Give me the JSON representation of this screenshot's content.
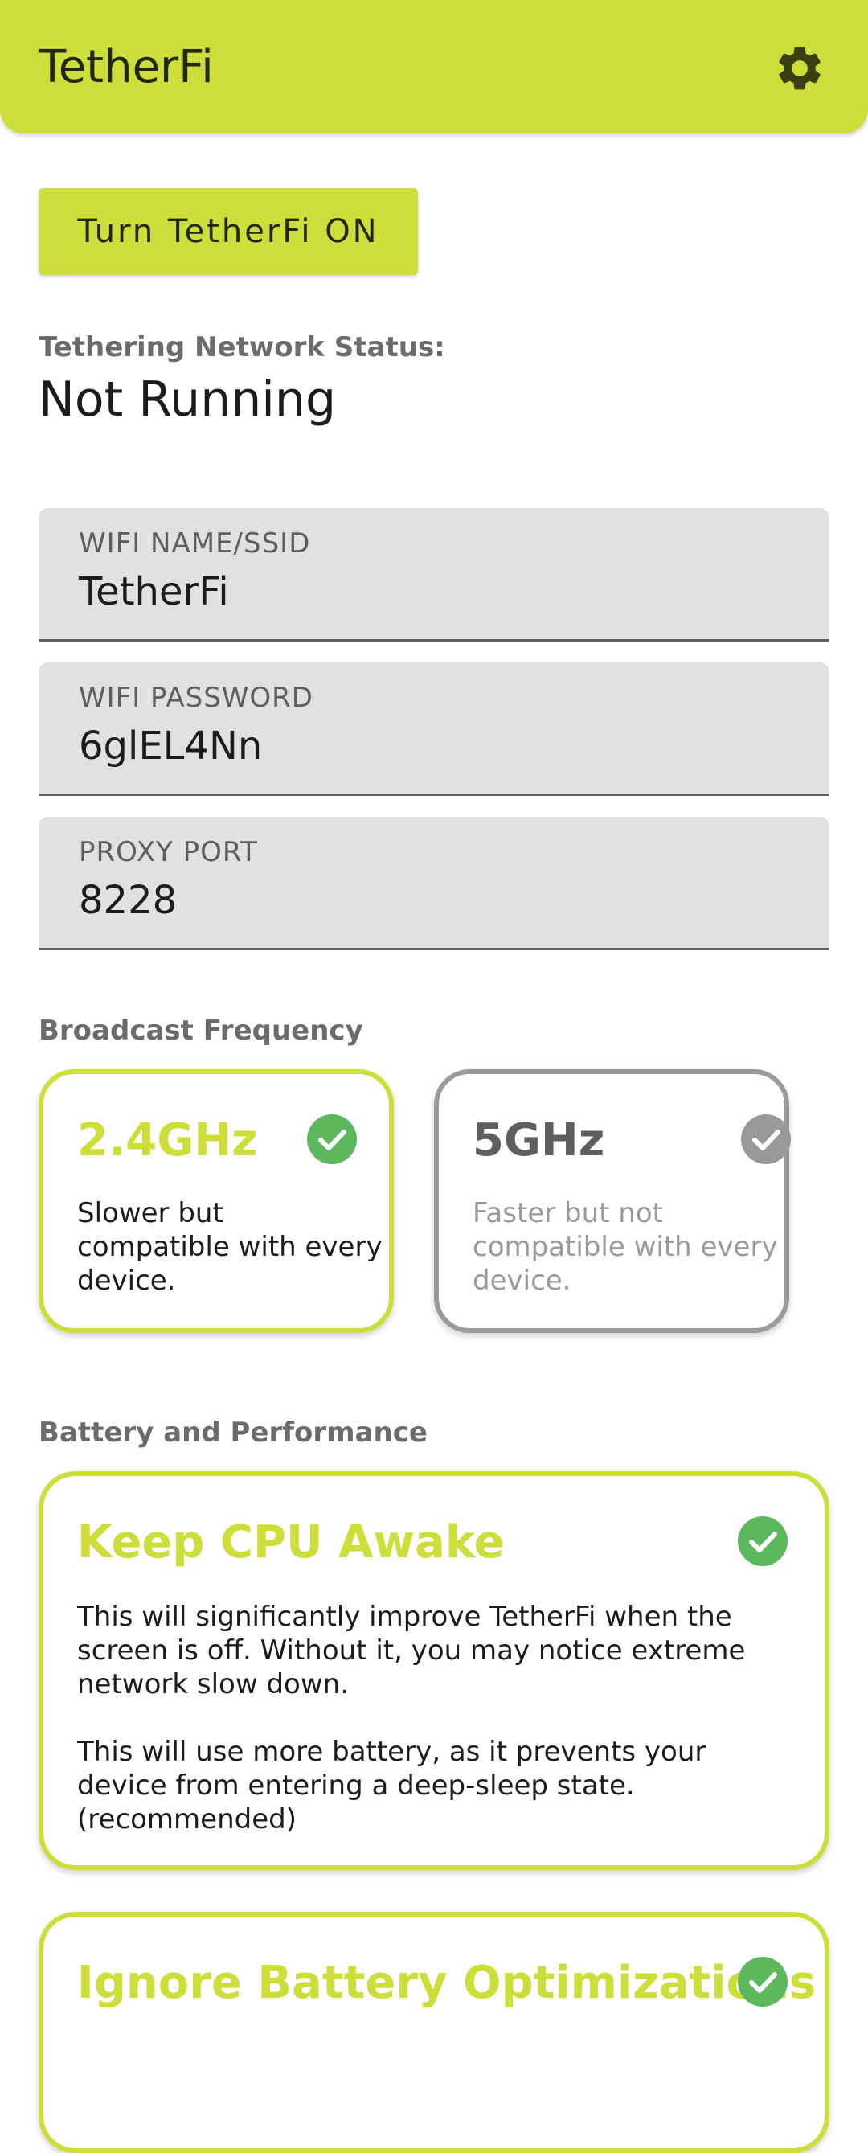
{
  "header": {
    "title": "TetherFi",
    "settings_icon": "gear-icon",
    "accent_color": "#cddd3a"
  },
  "toggle_button": {
    "label": "Turn TetherFi ON"
  },
  "status": {
    "label": "Tethering Network Status:",
    "value": "Not Running"
  },
  "fields": {
    "ssid": {
      "label": "WIFI NAME/SSID",
      "value": "TetherFi"
    },
    "password": {
      "label": "WIFI PASSWORD",
      "value": "6glEL4Nn"
    },
    "port": {
      "label": "PROXY PORT",
      "value": "8228"
    }
  },
  "broadcast": {
    "title": "Broadcast Frequency",
    "options": [
      {
        "label": "2.4GHz",
        "description": "Slower but compatible with every device.",
        "selected": true
      },
      {
        "label": "5GHz",
        "description": "Faster but not compatible with every device.",
        "selected": false
      }
    ]
  },
  "battery": {
    "title": "Battery and Performance",
    "cards": [
      {
        "title": "Keep CPU Awake",
        "paragraph1": "This will significantly improve TetherFi when the screen is off. Without it, you may notice extreme network slow down.",
        "paragraph2": "This will use more battery, as it prevents your device from entering a deep-sleep state. (recommended)",
        "checked": true
      },
      {
        "title": "Ignore Battery Optimizations",
        "checked": true
      }
    ]
  },
  "colors": {
    "check_on": "#5cb85c",
    "check_off": "#999999"
  }
}
